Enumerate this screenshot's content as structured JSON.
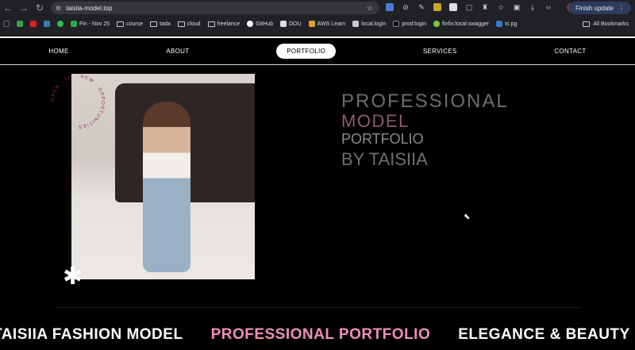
{
  "browser": {
    "url": "taisiia-model.top",
    "finish_update": "Finish update",
    "bookmarks": [
      "Fin - Nov 25",
      "course",
      "tada",
      "cloud",
      "freelance",
      "GitHub",
      "DOU",
      "AWS Learn",
      "local:login",
      "prod:login",
      "finfix:local:swagger",
      "ts pg"
    ],
    "all_bookmarks": "All Bookmarks"
  },
  "nav": {
    "items": [
      "HOME",
      "ABOUT",
      "PORTFOLIO",
      "SERVICES",
      "CONTACT"
    ],
    "active": "PORTFOLIO"
  },
  "badge": {
    "circular_text": "OPEN · TO · NEW · OPPORTUNITIES ·"
  },
  "hero": {
    "line1": "PROFESSIONAL",
    "line2": "MODEL",
    "line3": "PORTFOLIO",
    "line4": "BY TAISIIA"
  },
  "marquee": [
    "TAISIIA FASHION MODEL",
    "PROFESSIONAL PORTFOLIO",
    "ELEGANCE & BEAUTY"
  ],
  "colors": {
    "accent": "#ef8fb8",
    "model_text": "#8b5a6b"
  }
}
